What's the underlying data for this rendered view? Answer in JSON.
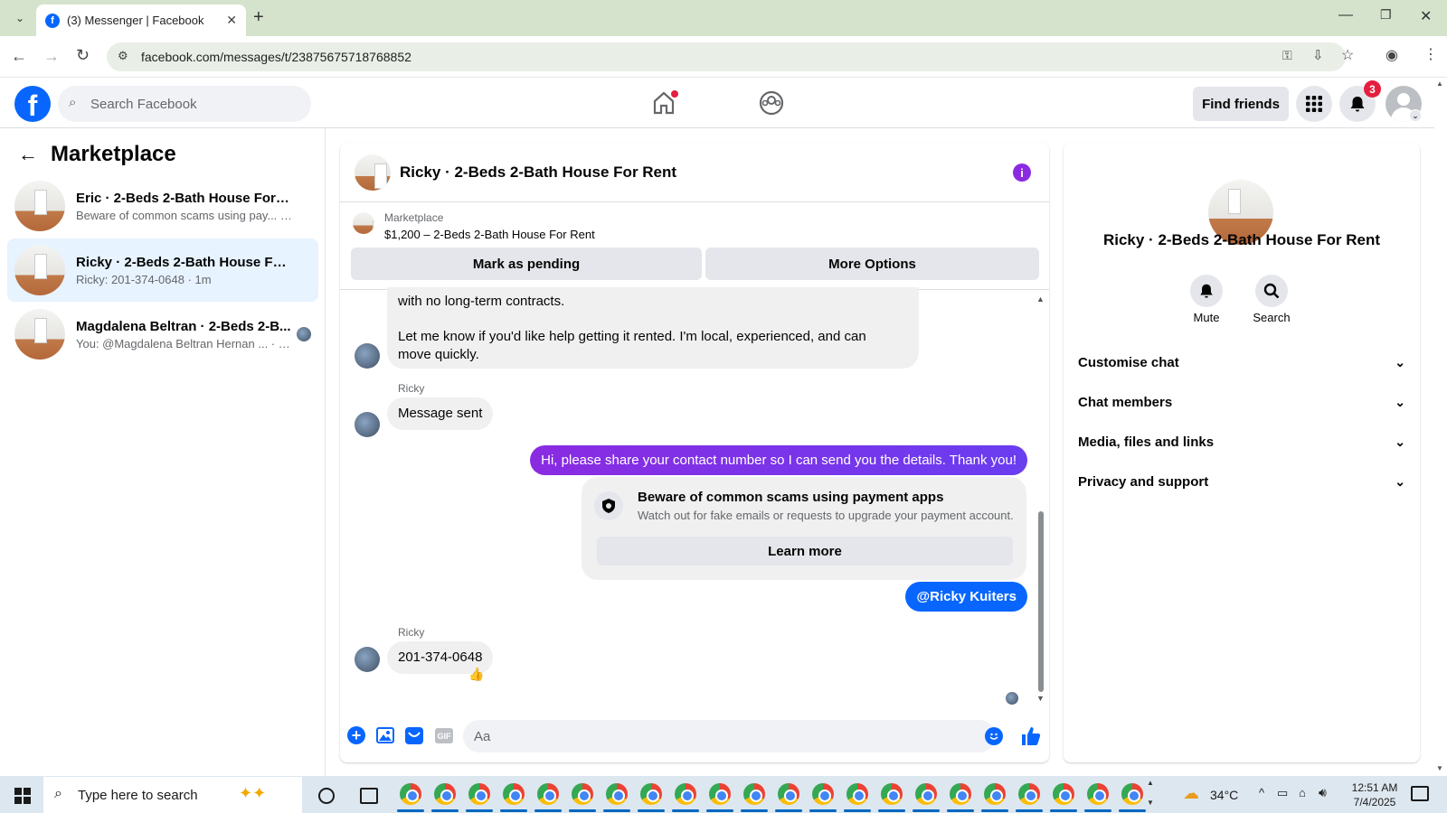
{
  "browser": {
    "tab_title": "(3) Messenger | Facebook",
    "url": "facebook.com/messages/t/23875675718768852"
  },
  "header": {
    "search_placeholder": "Search Facebook",
    "find_friends": "Find friends",
    "notification_count": "3"
  },
  "left": {
    "title": "Marketplace",
    "conversations": [
      {
        "title": "Eric · 2-Beds 2-Bath House For Rent",
        "sub": "Beware of common scams using pay... · 1m"
      },
      {
        "title": "Ricky · 2-Beds 2-Bath House For R...",
        "sub": "Ricky: 201-374-0648 · 1m"
      },
      {
        "title": "Magdalena Beltran · 2-Beds 2-B...",
        "sub": "You: @Magdalena Beltran Hernan ... · 1m"
      }
    ]
  },
  "chat": {
    "title": "Ricky · 2-Beds 2-Bath House For Rent",
    "listing_label": "Marketplace",
    "listing_price": "$1,200 – 2-Beds 2-Bath House For Rent",
    "mark_pending": "Mark as pending",
    "more_options": "More Options",
    "msg1_line1": "with no long-term contracts.",
    "msg1_line2": "Let me know if you'd like help getting it rented. I'm local, experienced, and can",
    "msg1_line3": "move quickly.",
    "sender1": "Ricky",
    "msg2": "Message sent",
    "my_msg": "Hi, please share your contact number so I can send you the details. Thank you!",
    "warn_title": "Beware of common scams using payment apps",
    "warn_sub": "Watch out for fake emails or requests to upgrade your payment account.",
    "learn_more": "Learn more",
    "mention": "@Ricky Kuiters",
    "sender2": "Ricky",
    "msg3": "201-374-0648",
    "reaction": "👍",
    "composer_placeholder": "Aa"
  },
  "right": {
    "name": "Ricky · 2-Beds 2-Bath House For Rent",
    "mute": "Mute",
    "search": "Search",
    "sections": [
      "Customise chat",
      "Chat members",
      "Media, files and links",
      "Privacy and support"
    ]
  },
  "taskbar": {
    "search_placeholder": "Type here to search",
    "temp": "34°C",
    "time": "12:51 AM",
    "date": "7/4/2025"
  },
  "colors": {
    "fb_blue": "#0866ff",
    "messenger_purple": "#7b2ff7",
    "badge_red": "#e41e3f"
  }
}
